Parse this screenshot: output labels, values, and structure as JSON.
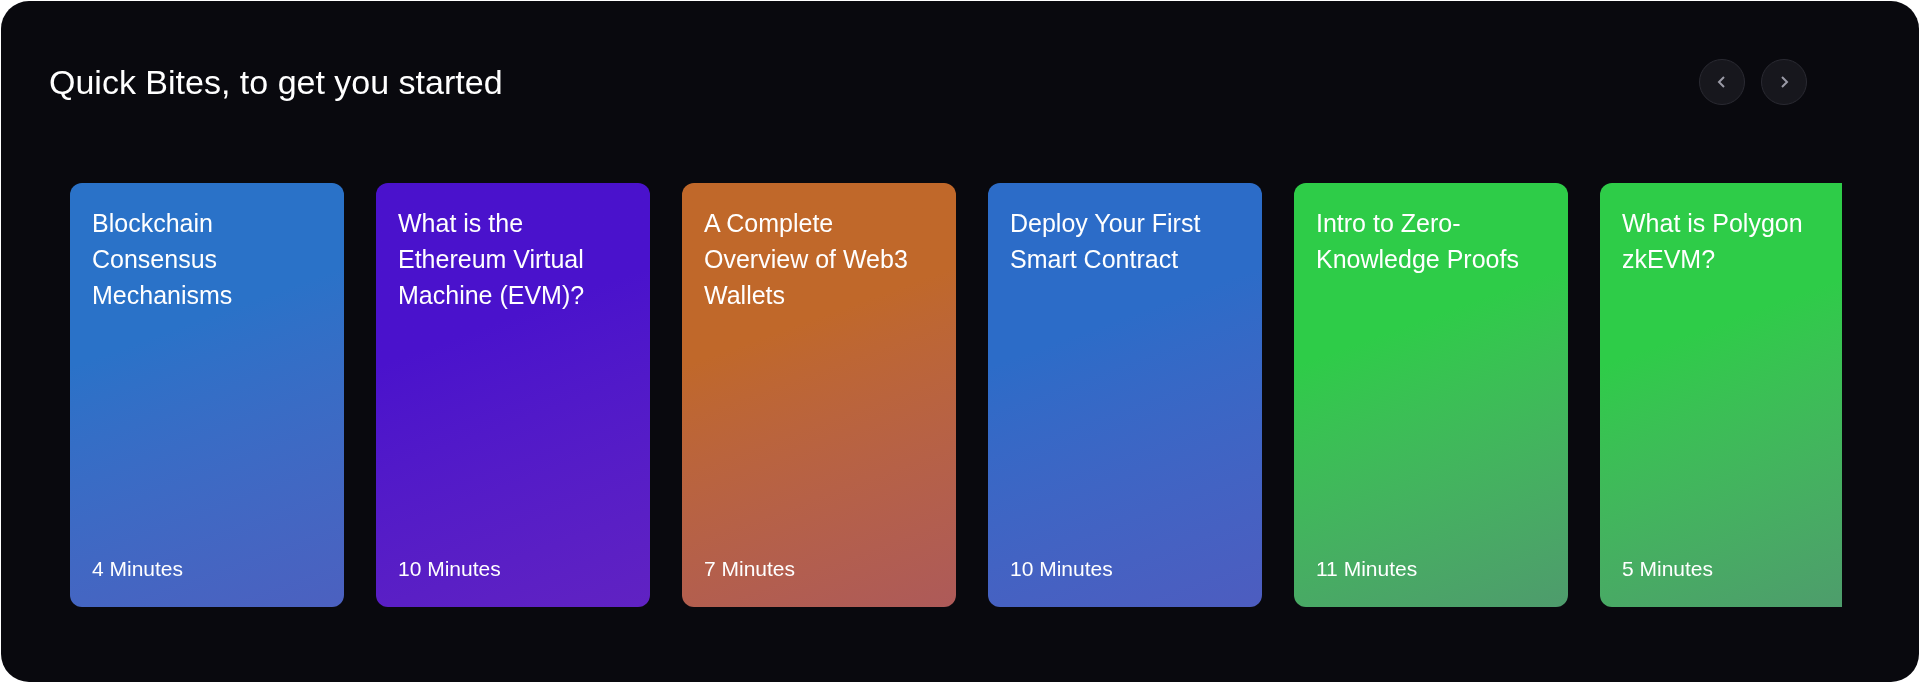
{
  "section": {
    "title": "Quick Bites, to get you started"
  },
  "nav_buttons": [
    {
      "kind": "previous"
    },
    {
      "kind": "next"
    }
  ],
  "cards": [
    {
      "title": "Blockchain Consensus Mechanisms",
      "duration": "4 Minutes",
      "color": "#2a72c8"
    },
    {
      "title": "What is the Ethereum Virtual Machine (EVM)?",
      "duration": "10 Minutes",
      "color": "#4a12cc"
    },
    {
      "title": "A Complete Overview of Web3 Wallets",
      "duration": "7 Minutes",
      "color": "#c0682a"
    },
    {
      "title": "Deploy Your First Smart Contract",
      "duration": "10 Minutes",
      "color": "#2c6cc8"
    },
    {
      "title": "Intro to Zero-Knowledge Proofs",
      "duration": "11 Minutes",
      "color": "#2ecc48"
    },
    {
      "title": "What is Polygon zkEVM?",
      "duration": "5 Minutes",
      "color": "#2ecc48"
    }
  ]
}
